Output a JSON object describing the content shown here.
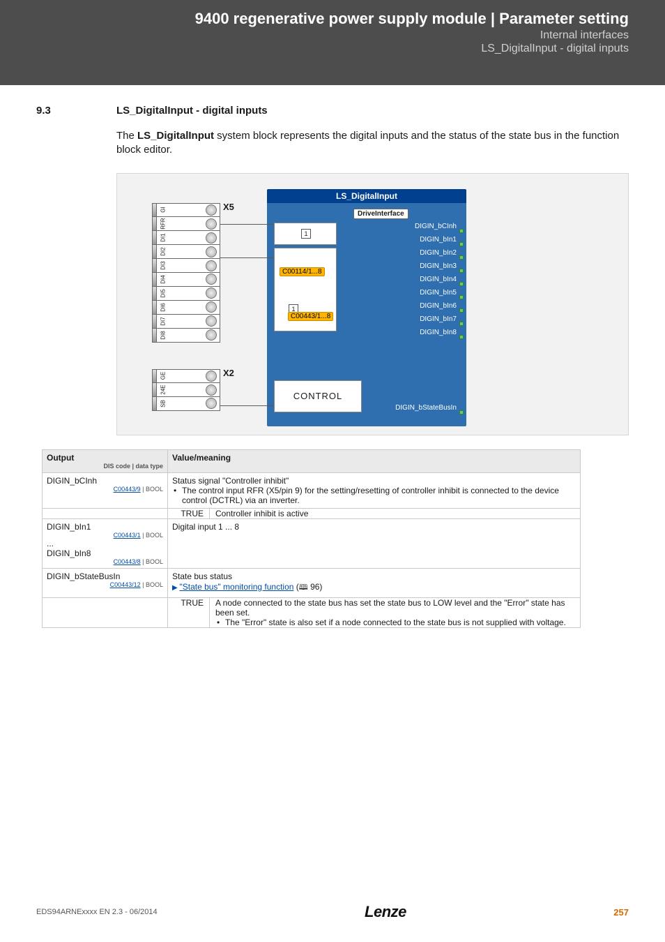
{
  "header": {
    "title": "9400 regenerative power supply module | Parameter setting",
    "sub1": "Internal interfaces",
    "sub2": "LS_DigitalInput - digital inputs"
  },
  "section": {
    "num": "9.3",
    "title": "LS_DigitalInput - digital inputs"
  },
  "intro": {
    "pre": "The ",
    "bold": "LS_DigitalInput",
    "post": " system block represents the digital inputs and the status of the state bus in the function block editor."
  },
  "diagram": {
    "ls_title": "LS_DigitalInput",
    "drive_interface": "DriveInterface",
    "x5_label": "X5",
    "x2_label": "X2",
    "x5_pins": [
      "GI",
      "RFR",
      "DI1",
      "DI2",
      "DI3",
      "DI4",
      "DI5",
      "DI6",
      "DI7",
      "DI8"
    ],
    "x2_pins": [
      "GE",
      "24E",
      "SB"
    ],
    "param1": "C00114/1...8",
    "param2": "C00443/1...8",
    "control": "CONTROL",
    "outputs": [
      "DIGIN_bCInh",
      "DIGIN_bIn1",
      "DIGIN_bIn2",
      "DIGIN_bIn3",
      "DIGIN_bIn4",
      "DIGIN_bIn5",
      "DIGIN_bIn6",
      "DIGIN_bIn7",
      "DIGIN_bIn8",
      "DIGIN_bStateBusIn"
    ]
  },
  "table": {
    "h1": "Output",
    "h1_hint": "DIS code | data type",
    "h2": "Value/meaning",
    "rows": [
      {
        "out": "DIGIN_bCInh",
        "code": "C00443/9",
        "type": " | BOOL",
        "value_heading": "Status signal \"Controller inhibit\"",
        "value_bullet": "The control input RFR (X5/pin 9) for the setting/resetting of controller inhibit is connected to the device control (DCTRL) via an inverter.",
        "sub_label": "TRUE",
        "sub_text": "Controller inhibit is active"
      },
      {
        "out1": "DIGIN_bIn1",
        "code1": "C00443/1",
        "type1": " | BOOL",
        "ellipsis": "...",
        "out2": "DIGIN_bIn8",
        "code2": "C00443/8",
        "type2": " | BOOL",
        "value_heading": "Digital input 1 ... 8"
      },
      {
        "out": "DIGIN_bStateBusIn",
        "code": "C00443/12",
        "type": " | BOOL",
        "value_heading": "State bus status",
        "value_link_pre": "\"State bus\" monitoring function",
        "value_link_page": " 96)",
        "sub_label": "TRUE",
        "sub_text1": "A node connected to the state bus has set the state bus to LOW level and the \"Error\" state has been set.",
        "sub_bullet": "The \"Error\" state is also set if a node connected to the state bus is not supplied with voltage."
      }
    ]
  },
  "footer": {
    "doc": "EDS94ARNExxxx EN 2.3 - 06/2014",
    "logo": "Lenze",
    "page": "257"
  }
}
